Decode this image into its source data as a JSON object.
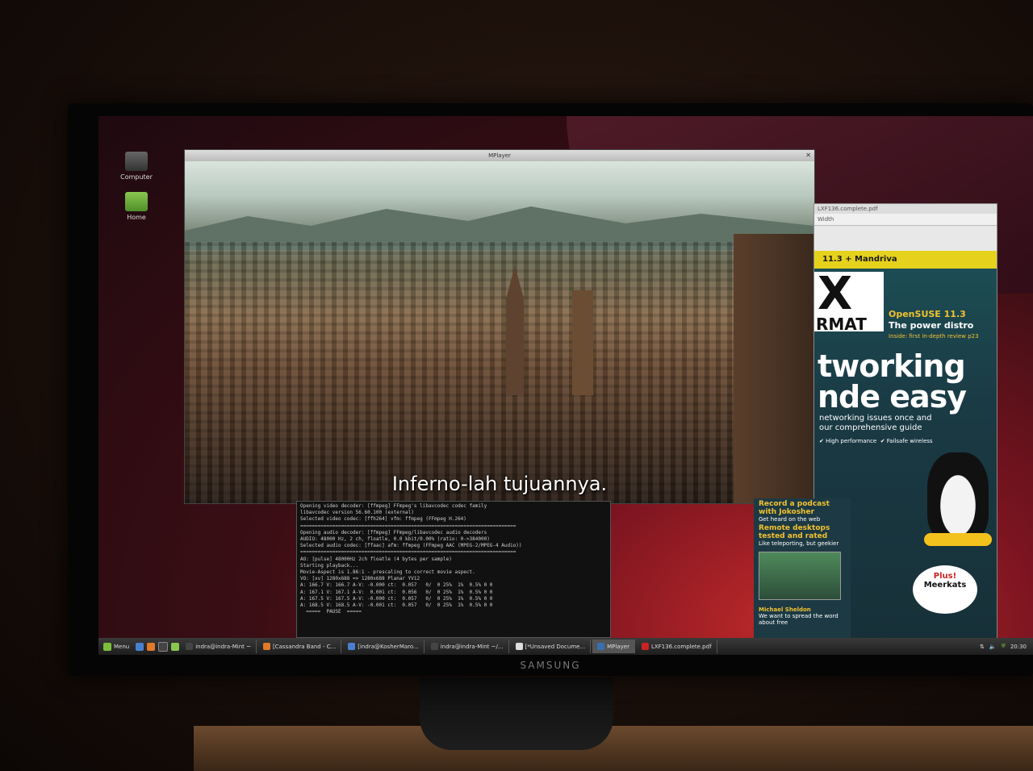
{
  "desktop": {
    "icons": [
      {
        "label": "Computer"
      },
      {
        "label": "Home"
      }
    ]
  },
  "mplayer": {
    "title": "MPlayer",
    "subtitle": "Inferno-lah tujuannya."
  },
  "terminal": {
    "lines": [
      "Opening video decoder: [ffmpeg] FFmpeg's libavcodec codec family",
      "libavcodec version 56.60.100 (external)",
      "Selected video codec: [ffh264] vfm: ffmpeg (FFmpeg H.264)",
      "==========================================================================",
      "Opening audio decoder: [ffmpeg] FFmpeg/libavcodec audio decoders",
      "AUDIO: 48000 Hz, 2 ch, floatle, 0.0 kbit/0.00% (ratio: 0->384000)",
      "Selected audio codec: [ffaac] afm: ffmpeg (FFmpeg AAC (MPEG-2/MPEG-4 Audio))",
      "==========================================================================",
      "AO: [pulse] 48000Hz 2ch floatle (4 bytes per sample)",
      "Starting playback...",
      "Movie-Aspect is 1.86:1 - prescaling to correct movie aspect.",
      "VO: [xv] 1280x688 => 1280x688 Planar YV12",
      "A: 166.7 V: 166.7 A-V: -0.000 ct:  0.057   0/  0 25%  1%  0.5% 0 0",
      "A: 167.1 V: 167.1 A-V:  0.001 ct:  0.056   0/  0 25%  1%  0.5% 0 0",
      "A: 167.5 V: 167.5 A-V: -0.000 ct:  0.057   0/  0 25%  1%  0.5% 0 0",
      "A: 168.5 V: 168.5 A-V: -0.001 ct:  0.057   0/  0 25%  1%  0.5% 0 0",
      "  =====  PAUSE  ====="
    ]
  },
  "pdf": {
    "title": "LXF136.complete.pdf",
    "toolbar": "Width",
    "cover": {
      "top_strip": "11.3 + Mandriva",
      "logo_x": "X",
      "logo_format": "RMAT",
      "sub1": "OpenSUSE 11.3",
      "sub2": "The power distro",
      "sub_small": "Inside: first in-depth review p23",
      "headline1": "tworking",
      "headline2": "nde easy",
      "tagline1": "networking issues once and",
      "tagline2": "our comprehensive guide",
      "feat1": "High performance",
      "feat2": "Failsafe wireless",
      "plus": "Plus!",
      "plus2": "Meerkats",
      "col_title1": "Record a podcast with Jokosher",
      "col_text1": "Get heard on the web",
      "col_title2": "Remote desktops tested and rated",
      "col_text2": "Like teleporting, but geekier",
      "col_quote_name": "Michael Sheldon",
      "col_quote": "We want to spread the word about free"
    }
  },
  "taskbar": {
    "menu_label": "Menu",
    "items": [
      {
        "label": "indra@indra-Mint ~"
      },
      {
        "label": "[Cassandra Band - C..."
      },
      {
        "label": "[indra@KosherMaro..."
      },
      {
        "label": "indra@indra-Mint ~/..."
      },
      {
        "label": "[*Unsaved Docume..."
      },
      {
        "label": "MPlayer"
      },
      {
        "label": "LXF136.complete.pdf"
      }
    ],
    "clock": "20:30",
    "monitor_brand": "SAMSUNG"
  },
  "colors": {
    "accent": "#7cbf3d",
    "magazine_yellow": "#e6d21c",
    "desktop_red": "#c22a2a"
  }
}
